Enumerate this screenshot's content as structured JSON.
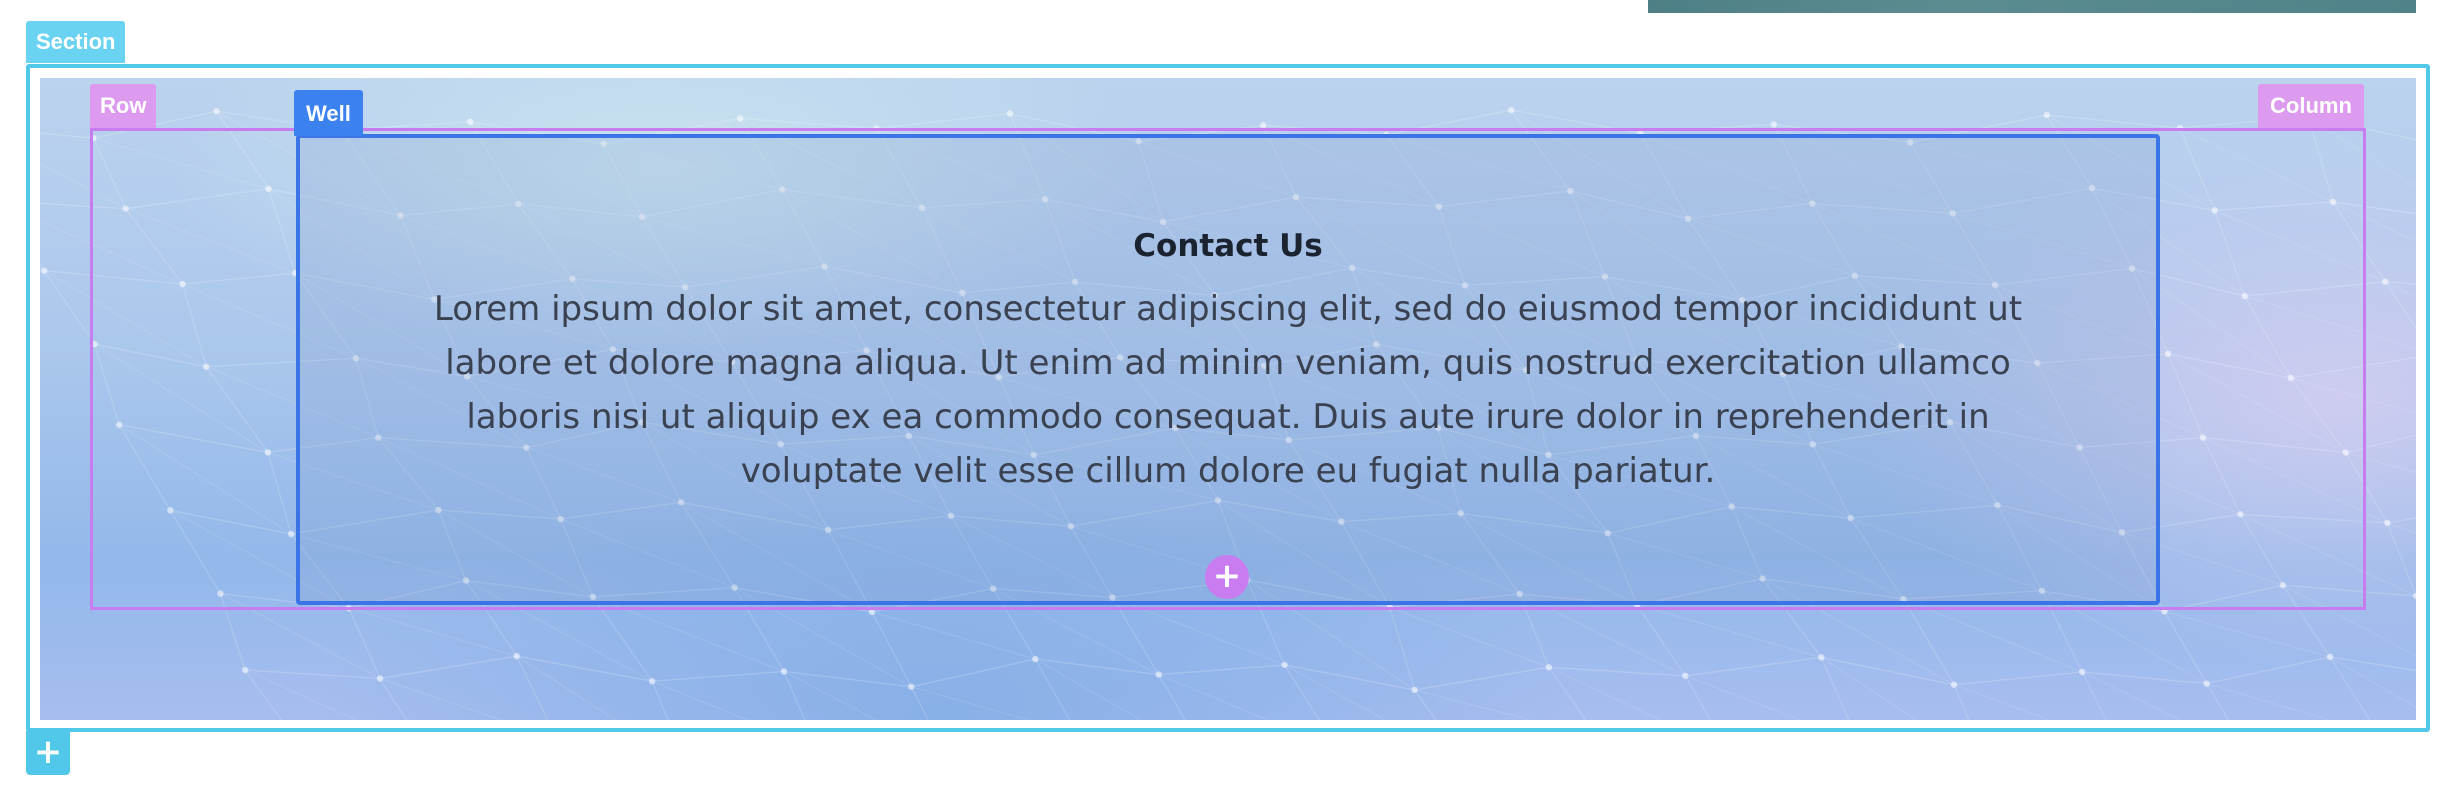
{
  "builder": {
    "section_label": "Section",
    "row_label": "Row",
    "column_label": "Column",
    "well_label": "Well",
    "add_module_icon": "plus-icon",
    "add_section_icon": "plus-icon",
    "add_symbol": "+"
  },
  "content": {
    "title": "Contact Us",
    "body": "Lorem ipsum dolor sit amet, consectetur adipiscing elit, sed do eiusmod tempor incididunt ut labore et dolore magna aliqua. Ut enim ad minim veniam, quis nostrud exercitation ullamco laboris nisi ut aliquip ex ea commodo consequat. Duis aute irure dolor in reprehenderit in voluptate velit esse cillum dolore eu fugiat nulla pariatur."
  },
  "colors": {
    "section_outline": "#51c7ea",
    "row_outline": "#c77df0",
    "well_outline": "#3b74e6",
    "well_tag": "#3b82f0",
    "add_module_button": "#c97cf0"
  }
}
